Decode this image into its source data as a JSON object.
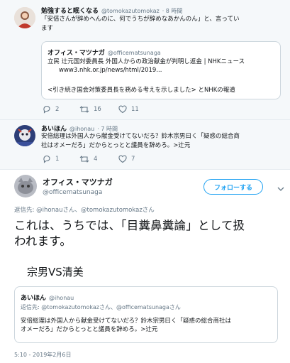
{
  "reply_tweet": {
    "author_name": "勉強すると眠くなる",
    "author_handle": "@tomokazutomokaz",
    "time": "· 8 時間",
    "text_line1": "「安倍さんが辞めへんのに、何でうちが辞めなあかんのん」と、言ってい",
    "text_line2": "ます",
    "quote": {
      "name": "オフィス・マツナガ",
      "handle": "@officematsunaga",
      "line1": "立民 辻元国対委員長 外国人からの政治献金が判明し返金 | NHKニュース",
      "line2": "www3.nhk.or.jp/news/html/2019...",
      "line3": "<引き続き国会対策委員長を務める考えを示しました> とNHKの報道"
    },
    "reply_count": "2",
    "retweet_count": "16",
    "like_count": "11"
  },
  "second_tweet": {
    "author_name": "あいほん",
    "author_handle": "@ihonau",
    "time": "· 7 時間",
    "text_line1": "安倍総理は外国人から献金受けてないだろ？鈴木宗男曰く「疑惑の総合商",
    "text_line2": "社はオメーだろ」だからとっとと議員を辞めろ。>辻元",
    "reply_count": "1",
    "retweet_count": "4",
    "like_count": "7"
  },
  "main_tweet": {
    "author_name": "オフィス・マツナガ",
    "author_handle": "@officematsunaga",
    "follow_label": "フォローする",
    "reply_to_prefix": "返信先:",
    "reply_to_users": "@ihonauさん、@tomokazutomokazさん",
    "text_line1": "これは、うちでは、「目糞鼻糞論」として扱",
    "text_line2": "われます。",
    "text_line3": "宗男VS清美",
    "quote": {
      "name": "あいほん",
      "handle": "@ihonau",
      "reply_to_prefix": "返信先:",
      "reply_to_users": "@tomokazutomokazさん、@officematsunagaさん",
      "line1": "安倍総理は外国人から献金受けてないだろ？鈴木宗男曰く「疑惑の総合商社は",
      "line2": "オメーだろ」だからとっとと議員を辞めろ。>辻元"
    },
    "timestamp": "5:10 - 2019年2月6日"
  },
  "colors": {
    "thread_bg": "#f5f8fa",
    "link_blue": "#1b95e0",
    "follow_blue": "#1da1f2",
    "muted_gray": "#657786"
  }
}
